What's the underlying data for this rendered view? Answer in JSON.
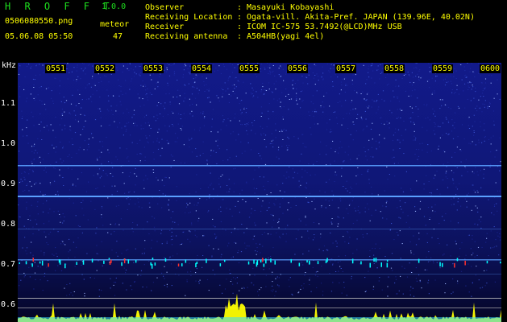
{
  "header": {
    "app_title": "H R O F F T",
    "app_version": "1.0.0",
    "filename": "0506080550.png",
    "meteor_label": "meteor",
    "timestamp": "05.06.08 05:50",
    "meteor_count": "47"
  },
  "info": [
    {
      "key": "Observer",
      "value": "Masayuki Kobayashi"
    },
    {
      "key": "Receiving Location",
      "value": "Ogata-vill. Akita-Pref. JAPAN (139.96E, 40.02N)"
    },
    {
      "key": "Receiver",
      "value": "ICOM IC-575 53.7492(@LCD)MHz USB"
    },
    {
      "key": "Receiving antenna",
      "value": "A504HB(yagi 4el)"
    }
  ],
  "info_colon": ":",
  "spectrogram": {
    "freq_unit": "kHz",
    "freq_ticks": [
      "1.1",
      "1.0",
      "0.9",
      "0.8",
      "0.7",
      "0.6"
    ],
    "time_labels": [
      "0551",
      "0552",
      "0553",
      "0554",
      "0555",
      "0556",
      "0557",
      "0558",
      "0559",
      "0600"
    ],
    "colors": {
      "background_noise": "#121a8a",
      "carrier_line": "#5aa0ff",
      "meteor_echo": "#00ffff",
      "power_trace": "#ffff00",
      "text_green": "#1ee01e",
      "text_yellow": "#ffff00"
    }
  }
}
